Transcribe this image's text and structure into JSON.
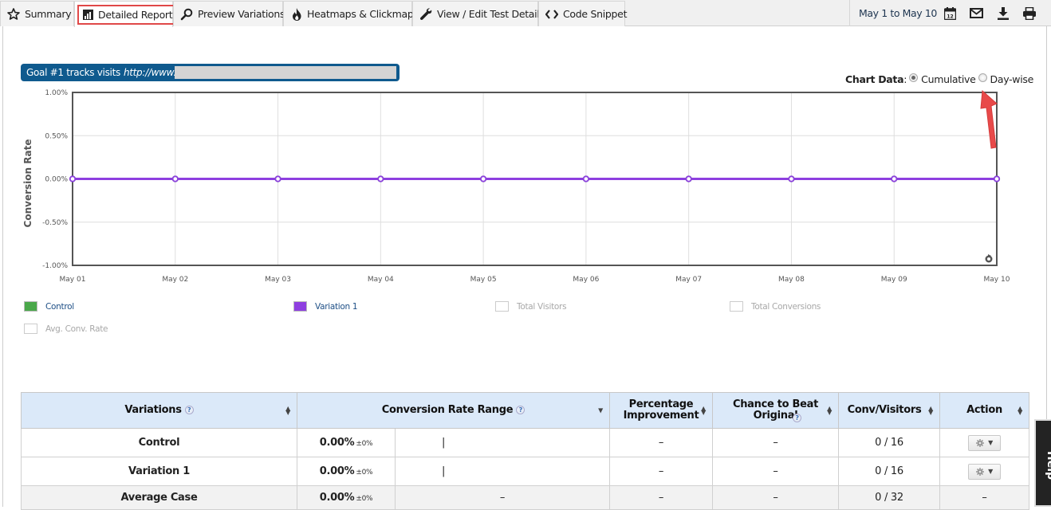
{
  "tabs": [
    {
      "label": "Summary",
      "icon": "star-icon",
      "active": false
    },
    {
      "label": "Detailed Report",
      "icon": "bar-chart-icon",
      "active": true
    },
    {
      "label": "Preview Variations",
      "icon": "magnifier-icon",
      "active": false
    },
    {
      "label": "Heatmaps & Clickmaps",
      "icon": "flame-icon",
      "active": false
    },
    {
      "label": "View / Edit Test Details",
      "icon": "wrench-icon",
      "active": false
    },
    {
      "label": "Code Snippet",
      "icon": "code-icon",
      "active": false
    }
  ],
  "toolbar": {
    "date_range": "May 1 to May 10",
    "calendar_day": "12",
    "icons": [
      "calendar-icon",
      "email-icon",
      "download-icon",
      "print-icon"
    ]
  },
  "goal": {
    "prefix": "Goal #1 tracks visits",
    "url": "http://www."
  },
  "chart_controls": {
    "label": "Chart Data",
    "options": [
      {
        "label": "Cumulative",
        "selected": true
      },
      {
        "label": "Day-wise",
        "selected": false
      }
    ]
  },
  "chart_data": {
    "type": "line",
    "title": "",
    "xlabel": "",
    "ylabel": "Conversion Rate",
    "x": [
      "May 01",
      "May 02",
      "May 03",
      "May 04",
      "May 05",
      "May 06",
      "May 07",
      "May 08",
      "May 09",
      "May 10"
    ],
    "yticks": [
      "1.00%",
      "0.50%",
      "0.00%",
      "-0.50%",
      "-1.00%"
    ],
    "ylim": [
      -1.0,
      1.0
    ],
    "grid": true,
    "series": [
      {
        "name": "Control",
        "color": "#4aa84a",
        "values": [
          0,
          0,
          0,
          0,
          0,
          0,
          0,
          0,
          0,
          0
        ],
        "visible": true
      },
      {
        "name": "Variation 1",
        "color": "#8e3fe0",
        "values": [
          0,
          0,
          0,
          0,
          0,
          0,
          0,
          0,
          0,
          0
        ],
        "visible": true
      }
    ],
    "legend": [
      {
        "label": "Control",
        "color": "#4aa84a",
        "active": true
      },
      {
        "label": "Variation 1",
        "color": "#8e3fe0",
        "active": true
      },
      {
        "label": "Total Visitors",
        "color": "",
        "active": false
      },
      {
        "label": "Total Conversions",
        "color": "",
        "active": false
      },
      {
        "label": "Avg. Conv. Rate",
        "color": "",
        "active": false
      }
    ]
  },
  "table": {
    "headers": [
      {
        "label": "Variations",
        "help": true,
        "sort": "both"
      },
      {
        "label": "Conversion Rate Range",
        "help": true,
        "sort": "down"
      },
      {
        "label": "Percentage Improvement",
        "help": false,
        "sort": "both"
      },
      {
        "label": "Chance to Beat Original",
        "help": true,
        "sort": "both"
      },
      {
        "label": "Conv/Visitors",
        "help": false,
        "sort": "both"
      },
      {
        "label": "Action",
        "help": false,
        "sort": "both"
      }
    ],
    "rows": [
      {
        "name": "Control",
        "rate": "0.00%",
        "range": "±0%",
        "range_bar": "|",
        "improvement": "–",
        "chance": "–",
        "conv_visitors": "0 / 16",
        "action": "gear"
      },
      {
        "name": "Variation 1",
        "rate": "0.00%",
        "range": "±0%",
        "range_bar": "|",
        "improvement": "–",
        "chance": "–",
        "conv_visitors": "0 / 16",
        "action": "gear"
      },
      {
        "name": "Average Case",
        "rate": "0.00%",
        "range": "±0%",
        "range_bar": "–",
        "improvement": "–",
        "chance": "–",
        "conv_visitors": "0 / 32",
        "action": "–"
      }
    ]
  },
  "help_tab": "Help"
}
